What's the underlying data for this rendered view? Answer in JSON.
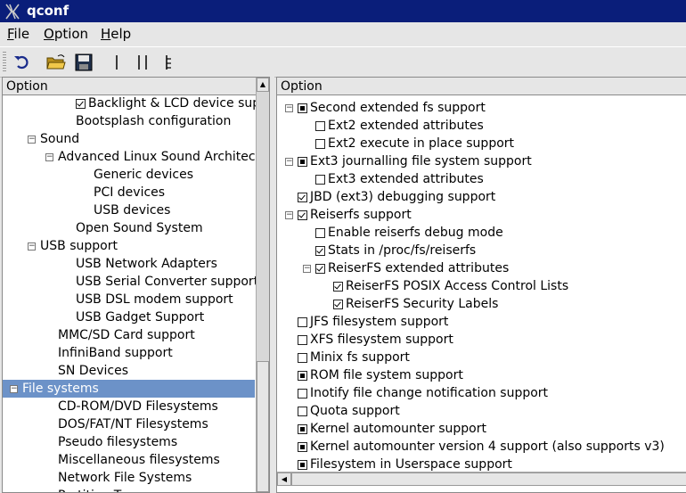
{
  "window": {
    "title": "qconf"
  },
  "menu": [
    {
      "label_pre": "",
      "label_u": "F",
      "label_post": "ile"
    },
    {
      "label_pre": "",
      "label_u": "O",
      "label_post": "ption"
    },
    {
      "label_pre": "",
      "label_u": "H",
      "label_post": "elp"
    }
  ],
  "toolbar": {
    "buttons": [
      "undo-icon",
      "open-folder-icon",
      "save-disk-icon",
      "single-view-icon",
      "split-view-icon",
      "full-view-icon"
    ]
  },
  "left_panel": {
    "header": "Option",
    "items": [
      {
        "label": "Backlight & LCD device support",
        "level": 3,
        "check": "checked"
      },
      {
        "label": "Bootsplash configuration",
        "level": 3
      },
      {
        "label": "Sound",
        "level": 1,
        "expander": "minus"
      },
      {
        "label": "Advanced Linux Sound Architecture",
        "level": 2,
        "expander": "minus"
      },
      {
        "label": "Generic devices",
        "level": 4
      },
      {
        "label": "PCI devices",
        "level": 4
      },
      {
        "label": "USB devices",
        "level": 4
      },
      {
        "label": "Open Sound System",
        "level": 3
      },
      {
        "label": "USB support",
        "level": 1,
        "expander": "minus"
      },
      {
        "label": "USB Network Adapters",
        "level": 3
      },
      {
        "label": "USB Serial Converter support",
        "level": 3
      },
      {
        "label": "USB DSL modem support",
        "level": 3
      },
      {
        "label": "USB Gadget Support",
        "level": 3
      },
      {
        "label": "MMC/SD Card support",
        "level": 2
      },
      {
        "label": "InfiniBand support",
        "level": 2
      },
      {
        "label": "SN Devices",
        "level": 2
      },
      {
        "label": "File systems",
        "level": 0,
        "expander": "minus",
        "selected": true
      },
      {
        "label": "CD-ROM/DVD Filesystems",
        "level": 2
      },
      {
        "label": "DOS/FAT/NT Filesystems",
        "level": 2
      },
      {
        "label": "Pseudo filesystems",
        "level": 2
      },
      {
        "label": "Miscellaneous filesystems",
        "level": 2
      },
      {
        "label": "Network File Systems",
        "level": 2
      },
      {
        "label": "Partition Types",
        "level": 2
      }
    ]
  },
  "right_panel": {
    "header": "Option",
    "items": [
      {
        "label": "Second extended fs support",
        "level": 0,
        "expander": "minus",
        "check": "mod"
      },
      {
        "label": "Ext2 extended attributes",
        "level": 1,
        "check": "none"
      },
      {
        "label": "Ext2 execute in place support",
        "level": 1,
        "check": "none"
      },
      {
        "label": "Ext3 journalling file system support",
        "level": 0,
        "expander": "minus",
        "check": "mod"
      },
      {
        "label": "Ext3 extended attributes",
        "level": 1,
        "check": "none"
      },
      {
        "label": "JBD (ext3) debugging support",
        "level": 0,
        "check": "checked"
      },
      {
        "label": "Reiserfs support",
        "level": 0,
        "expander": "minus",
        "check": "checked"
      },
      {
        "label": "Enable reiserfs debug mode",
        "level": 1,
        "check": "none"
      },
      {
        "label": "Stats in /proc/fs/reiserfs",
        "level": 1,
        "check": "checked"
      },
      {
        "label": "ReiserFS extended attributes",
        "level": 1,
        "expander": "minus",
        "check": "checked"
      },
      {
        "label": "ReiserFS POSIX Access Control Lists",
        "level": 2,
        "check": "checked"
      },
      {
        "label": "ReiserFS Security Labels",
        "level": 2,
        "check": "checked"
      },
      {
        "label": "JFS filesystem support",
        "level": 0,
        "check": "none"
      },
      {
        "label": "XFS filesystem support",
        "level": 0,
        "check": "none"
      },
      {
        "label": "Minix fs support",
        "level": 0,
        "check": "none"
      },
      {
        "label": "ROM file system support",
        "level": 0,
        "check": "mod"
      },
      {
        "label": "Inotify file change notification support",
        "level": 0,
        "check": "none"
      },
      {
        "label": "Quota support",
        "level": 0,
        "check": "none"
      },
      {
        "label": "Kernel automounter support",
        "level": 0,
        "check": "mod"
      },
      {
        "label": "Kernel automounter version 4 support (also supports v3)",
        "level": 0,
        "check": "mod"
      },
      {
        "label": "Filesystem in Userspace support",
        "level": 0,
        "check": "mod"
      }
    ]
  }
}
